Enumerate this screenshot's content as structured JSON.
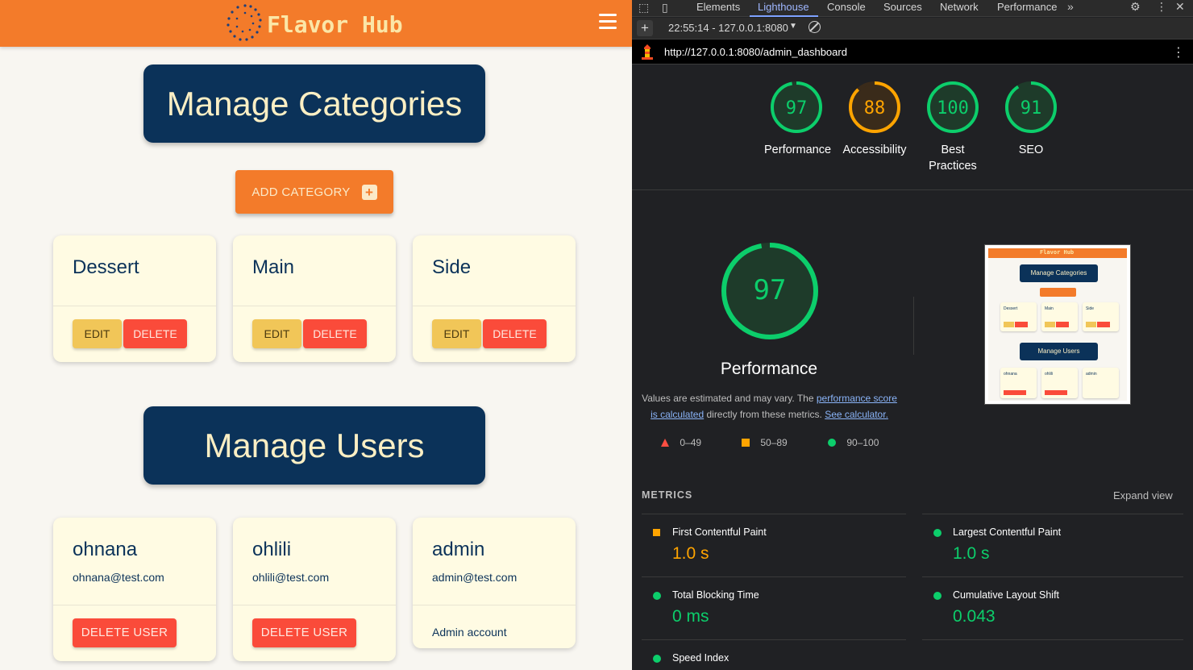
{
  "app": {
    "brand": "Flavor Hub",
    "categories_heading": "Manage Categories",
    "add_category_label": "ADD CATEGORY",
    "categories": [
      {
        "name": "Dessert",
        "edit_label": "EDIT",
        "delete_label": "DELETE"
      },
      {
        "name": "Main",
        "edit_label": "EDIT",
        "delete_label": "DELETE"
      },
      {
        "name": "Side",
        "edit_label": "EDIT",
        "delete_label": "DELETE"
      }
    ],
    "users_heading": "Manage Users",
    "users": [
      {
        "name": "ohnana",
        "email": "ohnana@test.com",
        "action": "DELETE USER"
      },
      {
        "name": "ohlili",
        "email": "ohlili@test.com",
        "action": "DELETE USER"
      },
      {
        "name": "admin",
        "email": "admin@test.com",
        "note": "Admin account"
      }
    ],
    "colors": {
      "header": "#f37b2a",
      "navy": "#0b3259",
      "card": "#fffbe3",
      "edit": "#f1c658",
      "delete": "#fa4b3a"
    }
  },
  "devtools": {
    "tabs": [
      "Elements",
      "Lighthouse",
      "Console",
      "Sources",
      "Network",
      "Performance"
    ],
    "active_tab": "Lighthouse",
    "report_selector": "22:55:14 - 127.0.0.1:8080",
    "url": "http://127.0.0.1:8080/admin_dashboard",
    "scores": [
      {
        "label": "Performance",
        "value": "97",
        "status": "pass"
      },
      {
        "label": "Accessibility",
        "value": "88",
        "status": "average"
      },
      {
        "label": "Best Practices",
        "value": "100",
        "status": "pass"
      },
      {
        "label": "SEO",
        "value": "91",
        "status": "pass"
      }
    ],
    "main_score": {
      "label": "Performance",
      "value": "97"
    },
    "description": {
      "prefix": "Values are estimated and may vary. The ",
      "link1": "performance score is calculated",
      "middle": " directly from these metrics. ",
      "link2": "See calculator."
    },
    "legend": [
      {
        "range": "0–49",
        "shape": "triangle",
        "color": "#ff4e42"
      },
      {
        "range": "50–89",
        "shape": "square",
        "color": "#ffa400"
      },
      {
        "range": "90–100",
        "shape": "circle",
        "color": "#0cce6b"
      }
    ],
    "metrics_label": "METRICS",
    "expand_label": "Expand view",
    "metrics": [
      {
        "label": "First Contentful Paint",
        "value": "1.0 s",
        "status": "average"
      },
      {
        "label": "Largest Contentful Paint",
        "value": "1.0 s",
        "status": "pass"
      },
      {
        "label": "Total Blocking Time",
        "value": "0 ms",
        "status": "pass"
      },
      {
        "label": "Cumulative Layout Shift",
        "value": "0.043",
        "status": "pass"
      },
      {
        "label": "Speed Index",
        "value": "",
        "status": "pass"
      }
    ],
    "thumbnail": {
      "brand": "Flavor Hub",
      "categories_heading": "Manage Categories",
      "users_heading": "Manage Users",
      "categories": [
        "Dessert",
        "Main",
        "Side"
      ],
      "users": [
        "ohnana",
        "ohlili",
        "admin"
      ]
    },
    "colors": {
      "pass": "#0cce6b",
      "average": "#ffa400",
      "fail": "#ff4e42"
    }
  }
}
